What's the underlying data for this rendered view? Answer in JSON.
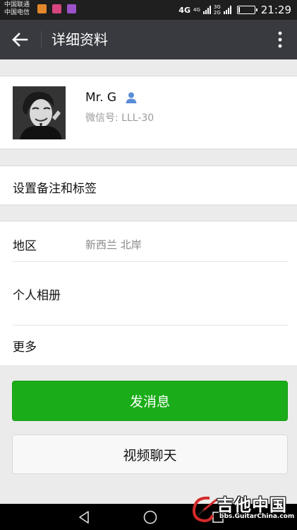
{
  "status_bar": {
    "carrier_1": "中国联通",
    "carrier_2": "中国电信",
    "network_1": "4G",
    "network_2": "4G",
    "network_3": "3G",
    "network_4": "2G",
    "battery_level": 0.1,
    "time": "21:29"
  },
  "header": {
    "title": "详细资料",
    "back_icon": "arrow-left-icon",
    "more_icon": "more-vertical-icon"
  },
  "profile": {
    "name": "Mr. G",
    "wechat_id": "微信号: LLL-30",
    "gender_icon": "male-user-icon",
    "gender_color": "#5b8ed6"
  },
  "remark": {
    "label": "设置备注和标签"
  },
  "info": {
    "region_label": "地区",
    "region_value": "新西兰  北岸",
    "album_label": "个人相册",
    "more_label": "更多"
  },
  "actions": {
    "send_message": "发消息",
    "video_call": "视频聊天",
    "primary_color": "#1aad19"
  },
  "watermark": {
    "title": "吉他中国",
    "url": "bbs.GuitarChina.com"
  }
}
